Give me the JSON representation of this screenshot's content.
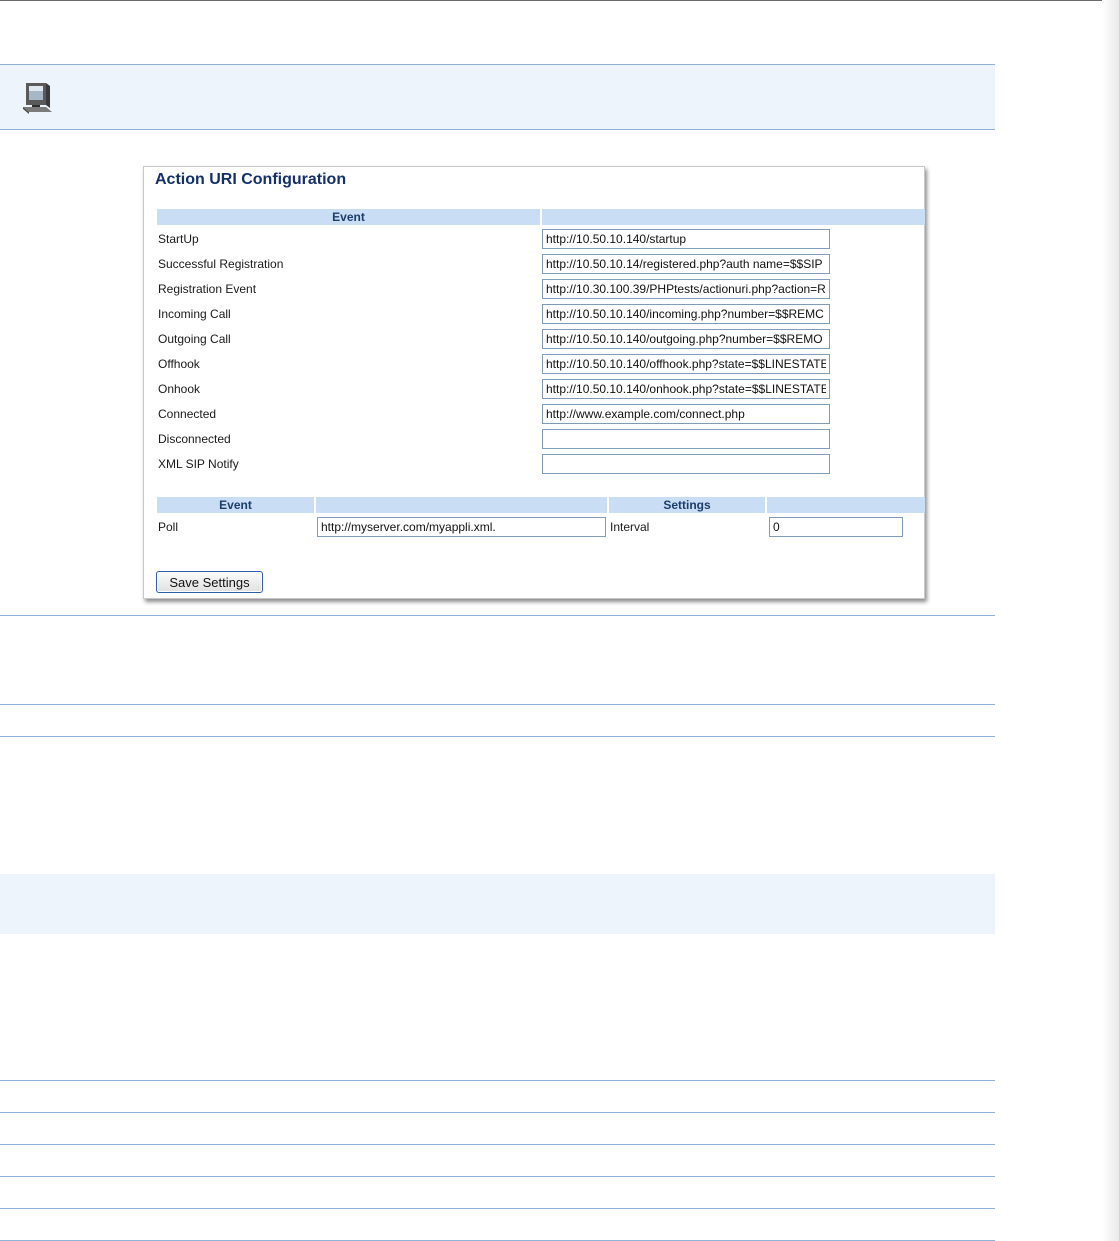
{
  "panel": {
    "title": "Action URI Configuration",
    "table1": {
      "header_event": "Event",
      "header_value": "",
      "rows": [
        {
          "label": "StartUp",
          "value": "http://10.50.10.140/startup"
        },
        {
          "label": "Successful Registration",
          "value": "http://10.50.10.14/registered.php?auth name=$$SIP"
        },
        {
          "label": "Registration Event",
          "value": "http://10.30.100.39/PHPtests/actionuri.php?action=R"
        },
        {
          "label": "Incoming Call",
          "value": "http://10.50.10.140/incoming.php?number=$$REMC"
        },
        {
          "label": "Outgoing Call",
          "value": "http://10.50.10.140/outgoing.php?number=$$REMO"
        },
        {
          "label": "Offhook",
          "value": "http://10.50.10.140/offhook.php?state=$$LINESTATE"
        },
        {
          "label": "Onhook",
          "value": "http://10.50.10.140/onhook.php?state=$$LINESTATE"
        },
        {
          "label": "Connected",
          "value": "http://www.example.com/connect.php"
        },
        {
          "label": "Disconnected",
          "value": ""
        },
        {
          "label": "XML SIP Notify",
          "value": ""
        }
      ]
    },
    "table2": {
      "header_event": "Event",
      "header_settings": "Settings",
      "poll_label": "Poll",
      "poll_value": "http://myserver.com/myappli.xml.",
      "interval_label": "Interval",
      "interval_value": "0"
    },
    "save_label": "Save Settings"
  },
  "icons": {
    "header_icon": "computer-icon"
  },
  "colors": {
    "band": "#edf4fb",
    "rule": "#8fb3d6",
    "table_header": "#c9def4",
    "title": "#13306a"
  }
}
